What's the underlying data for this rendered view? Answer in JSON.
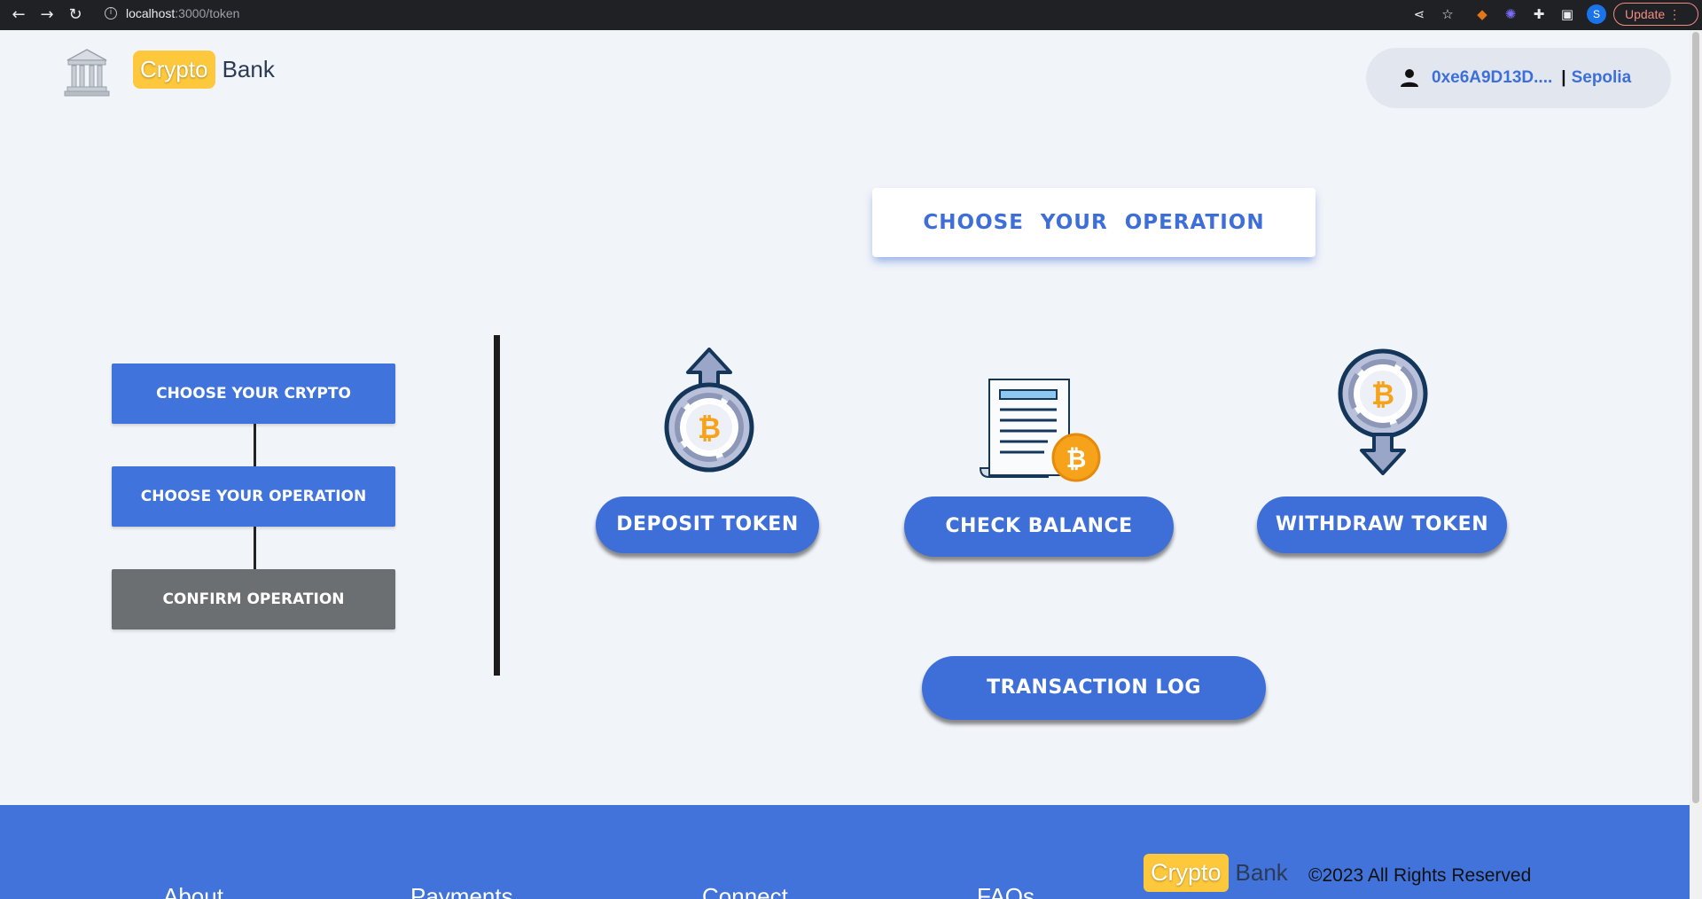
{
  "browser": {
    "url_host": "localhost",
    "url_path": ":3000/token",
    "profile_initial": "S",
    "update_label": "Update"
  },
  "header": {
    "brand_pill": "Crypto",
    "brand_text": "Bank",
    "wallet_address": "0xe6A9D13D....",
    "separator": "|",
    "network": "Sepolia"
  },
  "main": {
    "title": "CHOOSE YOUR OPERATION",
    "steps": [
      {
        "label": "CHOOSE YOUR CRYPTO"
      },
      {
        "label": "CHOOSE YOUR OPERATION"
      },
      {
        "label": "CONFIRM OPERATION"
      }
    ],
    "operations": {
      "deposit": "DEPOSIT TOKEN",
      "balance": "CHECK BALANCE",
      "withdraw": "WITHDRAW TOKEN",
      "log": "TRANSACTION LOG"
    }
  },
  "footer": {
    "links": [
      "About",
      "Payments",
      "Connect",
      "FAQs"
    ],
    "brand_pill": "Crypto",
    "brand_text": "Bank",
    "copyright": "©2023 All Rights Reserved"
  },
  "colors": {
    "accent": "#3e6fd8",
    "step_active": "#4074dc",
    "step_inactive": "#6c6f72",
    "brand_yellow": "#fdc83b",
    "bitcoin_orange": "#f7a21b"
  }
}
